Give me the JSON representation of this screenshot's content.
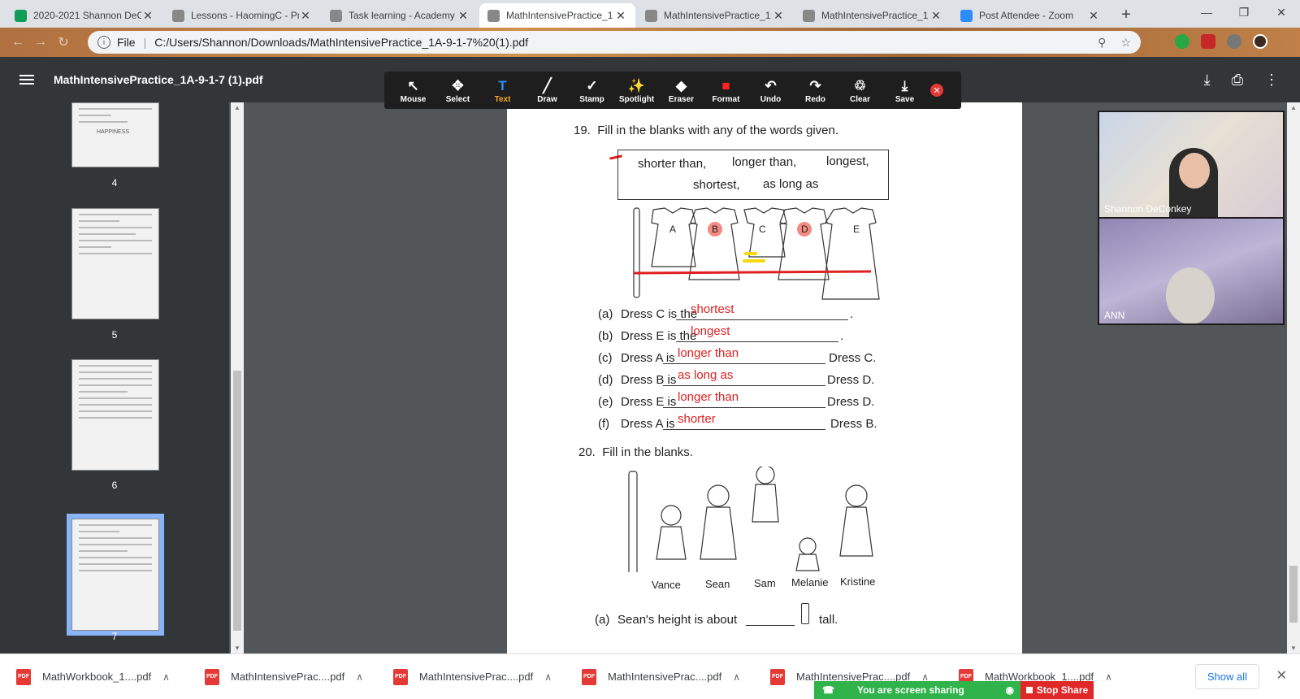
{
  "browser": {
    "tabs": [
      {
        "title": "2020-2021 Shannon DeC",
        "icon": "sheets-icon",
        "color": "#0f9d58"
      },
      {
        "title": "Lessons - HaomingC - Pr",
        "icon": "academy-icon",
        "color": "#888"
      },
      {
        "title": "Task learning - Academy",
        "icon": "academy-icon",
        "color": "#888"
      },
      {
        "title": "MathIntensivePractice_1",
        "icon": "globe-icon",
        "color": "#888"
      },
      {
        "title": "MathIntensivePractice_1",
        "icon": "globe-icon",
        "color": "#888"
      },
      {
        "title": "MathIntensivePractice_1",
        "icon": "globe-icon",
        "color": "#888"
      },
      {
        "title": "Post Attendee - Zoom",
        "icon": "zoom-icon",
        "color": "#2d8cff"
      }
    ],
    "address": {
      "scheme": "File",
      "url": "C:/Users/Shannon/Downloads/MathIntensivePractice_1A-9-1-7%20(1).pdf"
    }
  },
  "pdf": {
    "title": "MathIntensivePractice_1A-9-1-7 (1).pdf",
    "toolbar": [
      {
        "label": "Mouse",
        "icon": "cursor-icon"
      },
      {
        "label": "Select",
        "icon": "move-icon"
      },
      {
        "label": "Text",
        "icon": "text-icon"
      },
      {
        "label": "Draw",
        "icon": "pen-icon"
      },
      {
        "label": "Stamp",
        "icon": "check-icon"
      },
      {
        "label": "Spotlight",
        "icon": "wand-icon"
      },
      {
        "label": "Eraser",
        "icon": "eraser-icon"
      },
      {
        "label": "Format",
        "icon": "color-swatch-icon"
      },
      {
        "label": "Undo",
        "icon": "undo-icon"
      },
      {
        "label": "Redo",
        "icon": "redo-icon"
      },
      {
        "label": "Clear",
        "icon": "trash-icon"
      },
      {
        "label": "Save",
        "icon": "save-icon"
      }
    ],
    "selected_tool": "Text",
    "sidebar": {
      "pages": [
        "4",
        "5",
        "6",
        "7"
      ],
      "current_page": "7",
      "thumb4_text": "HAPPINESS"
    },
    "content": {
      "q19": {
        "number": "19.",
        "prompt": "Fill in the blanks with any of the words given."
      },
      "words": [
        "shorter than,",
        "longer than,",
        "longest,",
        "shortest,",
        "as long as"
      ],
      "dresses": [
        "A",
        "B",
        "C",
        "D",
        "E"
      ],
      "answers": [
        {
          "label": "(a)",
          "pre": "Dress C is the",
          "fill": "shortest",
          "post": "."
        },
        {
          "label": "(b)",
          "pre": "Dress E is the",
          "fill": "longest",
          "post": "."
        },
        {
          "label": "(c)",
          "pre": "Dress A is",
          "fill": "longer than",
          "post": "Dress C."
        },
        {
          "label": "(d)",
          "pre": "Dress B is",
          "fill": "as long as",
          "post": "Dress D."
        },
        {
          "label": "(e)",
          "pre": "Dress E is",
          "fill": "longer than",
          "post": "Dress D."
        },
        {
          "label": "(f)",
          "pre": "Dress A is",
          "fill": "shorter",
          "post": "Dress B."
        }
      ],
      "q20": {
        "number": "20.",
        "prompt": "Fill in the blanks."
      },
      "people": [
        "Vance",
        "Sean",
        "Sam",
        "Melanie",
        "Kristine"
      ],
      "q20a": {
        "label": "(a)",
        "pre": "Sean's height is about",
        "post": "tall."
      }
    }
  },
  "zoom": {
    "participants": [
      {
        "name": "Shannon DeConkey"
      },
      {
        "name": "ANN"
      }
    ],
    "sharing_text": "You are screen sharing",
    "stop_label": "Stop Share"
  },
  "downloads": {
    "items": [
      "MathWorkbook_1....pdf",
      "MathIntensivePrac....pdf",
      "MathIntensivePrac....pdf",
      "MathIntensivePrac....pdf",
      "MathIntensivePrac....pdf",
      "MathWorkbook_1....pdf"
    ],
    "show_all": "Show all"
  }
}
